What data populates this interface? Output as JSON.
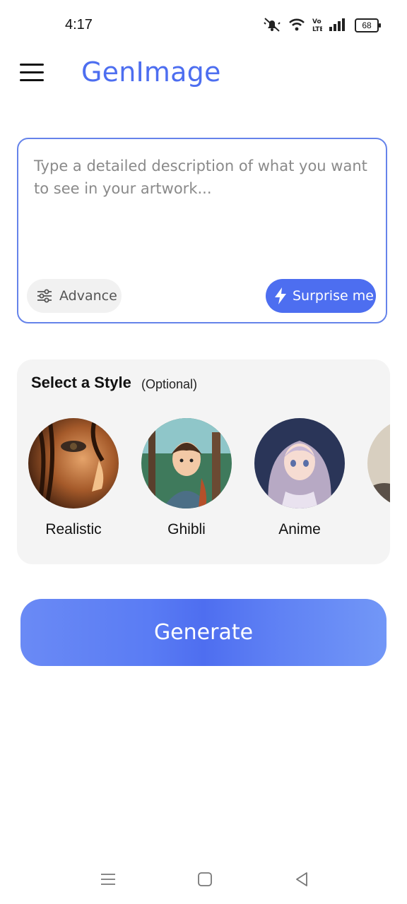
{
  "status_bar": {
    "time": "4:17",
    "battery": "68"
  },
  "header": {
    "app_title": "GenImage"
  },
  "prompt": {
    "placeholder": "Type a detailed description of what you want to see in your artwork...",
    "value": "",
    "advance_label": "Advance",
    "surprise_label": "Surprise me"
  },
  "style_section": {
    "title": "Select a Style",
    "subtitle": "(Optional)",
    "styles": [
      {
        "label": "Realistic"
      },
      {
        "label": "Ghibli"
      },
      {
        "label": "Anime"
      },
      {
        "label": ""
      }
    ]
  },
  "generate_label": "Generate",
  "colors": {
    "accent": "#4d6ef0",
    "border": "#6583ea",
    "card_bg": "#f4f4f4"
  }
}
